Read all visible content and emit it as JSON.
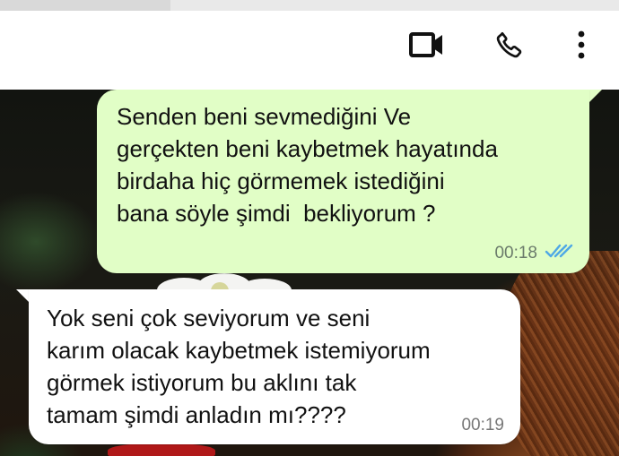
{
  "header": {
    "icons": [
      "video-call-icon",
      "phone-call-icon",
      "more-options-icon"
    ]
  },
  "messages": {
    "outgoing": {
      "lines": [
        "Senden beni sevmediğini Ve",
        "gerçekten beni kaybetmek hayatında",
        "birdaha hiç görmemek istediğini",
        "bana söyle şimdi  bekliyorum ?"
      ],
      "time": "00:18",
      "status_icon": "double-check-read-icon",
      "tick_color": "#4fa8e6",
      "bubble_color": "#e1fec6"
    },
    "incoming": {
      "lines": [
        "Yok seni çok seviyorum ve seni",
        "karım olacak kaybetmek istemiyorum",
        "görmek istiyorum bu aklını tak",
        "tamam şimdi anladın mı????"
      ],
      "time": "00:19",
      "bubble_color": "#ffffff"
    }
  }
}
